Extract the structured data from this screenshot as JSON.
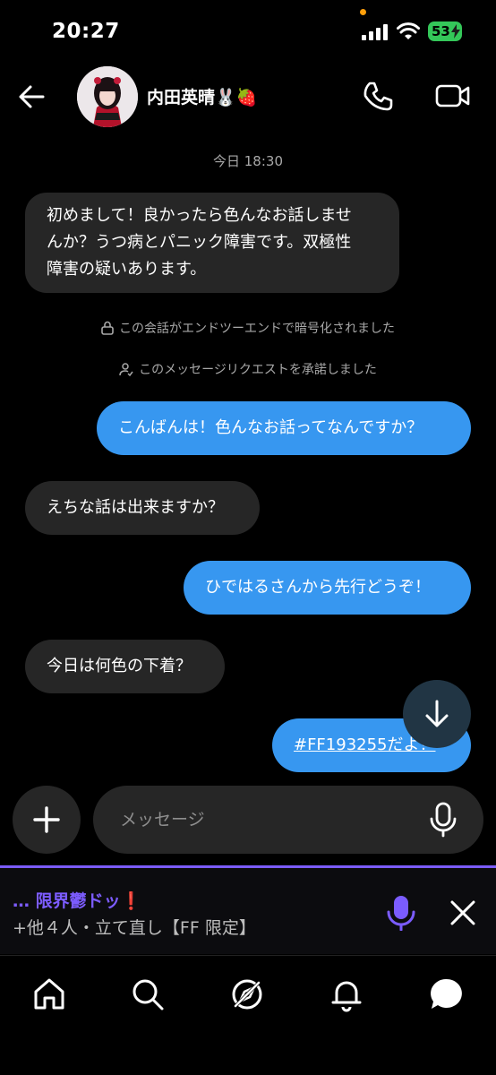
{
  "status_bar": {
    "time": "20:27",
    "battery": "53"
  },
  "header": {
    "contact_name": "内田英晴🐰🍓",
    "back_icon": "arrow-left-icon",
    "call_icon": "phone-icon",
    "video_icon": "video-camera-icon"
  },
  "chat": {
    "timestamp": "今日 18:30",
    "messages": [
      {
        "direction": "in",
        "text_lines": [
          "初めまして！良かったら色んなお話しませ",
          "んか？うつ病とパニック障害です。双極性",
          "障害の疑いあります。"
        ]
      },
      {
        "direction": "out",
        "text": "こんばんは！色んなお話ってなんですか？"
      },
      {
        "direction": "in",
        "text": "えちな話は出来ますか？"
      },
      {
        "direction": "out",
        "text": "ひではるさんから先行どうぞ！"
      },
      {
        "direction": "in",
        "text": "今日は何色の下着？"
      },
      {
        "direction": "out",
        "text": "#FF193255だよ！"
      }
    ],
    "system_notes": [
      {
        "icon": "lock-icon",
        "text": "この会話がエンドツーエンドで暗号化されました"
      },
      {
        "icon": "person-check-icon",
        "text": "このメッセージリクエストを承諾しました"
      }
    ]
  },
  "composer": {
    "placeholder": "メッセージ",
    "plus_icon": "plus-icon",
    "mic_icon": "microphone-icon"
  },
  "live_panel": {
    "title": "… 限界鬱ドッ❗",
    "subtitle": "+他４人・立て直し【FF 限定】",
    "accent_color": "#7b5cff"
  },
  "tab_bar": {
    "tabs": [
      "home-icon",
      "search-icon",
      "explore-icon",
      "notifications-icon",
      "messages-icon"
    ]
  },
  "colors": {
    "outgoing_bubble": "#3797f0",
    "incoming_bubble": "#262626",
    "background": "#000000"
  }
}
